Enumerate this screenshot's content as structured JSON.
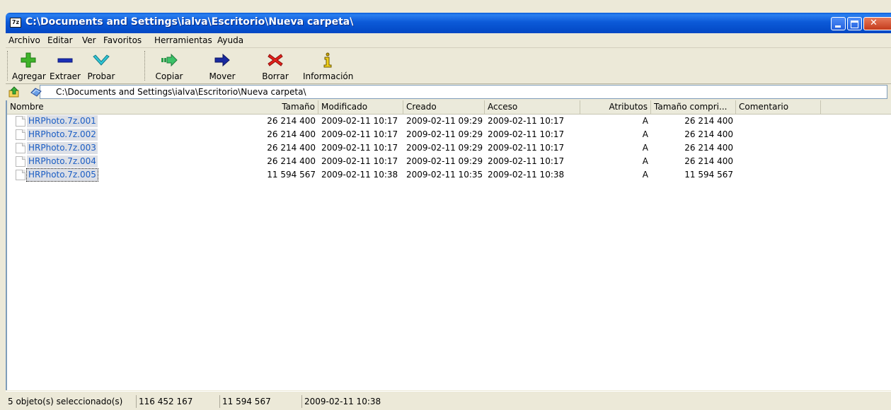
{
  "window": {
    "title": "C:\\Documents and Settings\\ialva\\Escritorio\\Nueva carpeta\\",
    "app_icon_text": "7z"
  },
  "menu": [
    "Archivo",
    "Editar",
    "Ver",
    "Favoritos",
    "Herramientas",
    "Ayuda"
  ],
  "toolbar": {
    "agregar": "Agregar",
    "extraer": "Extraer",
    "probar": "Probar",
    "copiar": "Copiar",
    "mover": "Mover",
    "borrar": "Borrar",
    "informacion": "Información"
  },
  "address": {
    "path": "C:\\Documents and Settings\\ialva\\Escritorio\\Nueva carpeta\\"
  },
  "columns": [
    "Nombre",
    "Tamaño",
    "Modificado",
    "Creado",
    "Acceso",
    "Atributos",
    "Tamaño compri...",
    "Comentario"
  ],
  "files": [
    {
      "name": "HRPhoto.7z.001",
      "size": "26 214 400",
      "modified": "2009-02-11 10:17",
      "created": "2009-02-11 09:29",
      "accessed": "2009-02-11 10:17",
      "attributes": "A",
      "packed": "26 214 400",
      "comment": ""
    },
    {
      "name": "HRPhoto.7z.002",
      "size": "26 214 400",
      "modified": "2009-02-11 10:17",
      "created": "2009-02-11 09:29",
      "accessed": "2009-02-11 10:17",
      "attributes": "A",
      "packed": "26 214 400",
      "comment": ""
    },
    {
      "name": "HRPhoto.7z.003",
      "size": "26 214 400",
      "modified": "2009-02-11 10:17",
      "created": "2009-02-11 09:29",
      "accessed": "2009-02-11 10:17",
      "attributes": "A",
      "packed": "26 214 400",
      "comment": ""
    },
    {
      "name": "HRPhoto.7z.004",
      "size": "26 214 400",
      "modified": "2009-02-11 10:17",
      "created": "2009-02-11 09:29",
      "accessed": "2009-02-11 10:17",
      "attributes": "A",
      "packed": "26 214 400",
      "comment": ""
    },
    {
      "name": "HRPhoto.7z.005",
      "size": "11 594 567",
      "modified": "2009-02-11 10:38",
      "created": "2009-02-11 10:35",
      "accessed": "2009-02-11 10:38",
      "attributes": "A",
      "packed": "11 594 567",
      "comment": ""
    }
  ],
  "status": {
    "selection": "5 objeto(s) seleccionado(s)",
    "total_size": "116 452 167",
    "focused_size": "11 594 567",
    "focused_modified": "2009-02-11 10:38"
  },
  "colors": {
    "titlebar": "#0247c4",
    "window_bg": "#ece9d8",
    "selected_text": "#1a5dc4",
    "selection_bg": "#dcdfe6"
  }
}
